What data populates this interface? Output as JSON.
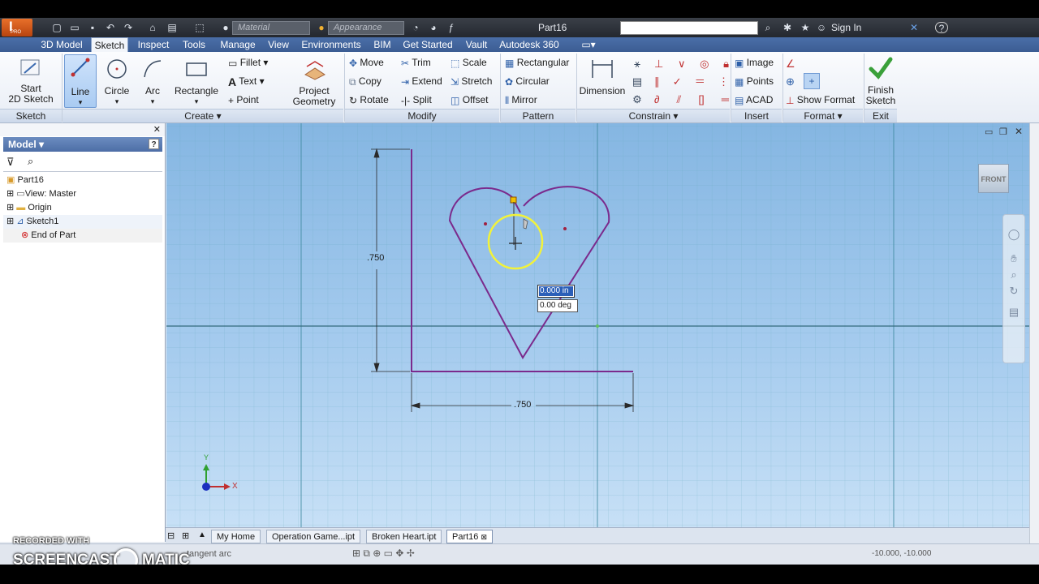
{
  "title_bar": {
    "material_placeholder": "Material",
    "appearance_placeholder": "Appearance",
    "doc_title": "Part16",
    "sign_in": "Sign In",
    "help": "?"
  },
  "tabs": [
    "3D Model",
    "Sketch",
    "Inspect",
    "Tools",
    "Manage",
    "View",
    "Environments",
    "BIM",
    "Get Started",
    "Vault",
    "Autodesk 360"
  ],
  "ribbon": {
    "sketch_panel": {
      "start": "Start",
      "start2": "2D Sketch",
      "label": "Sketch"
    },
    "create": {
      "line": "Line",
      "circle": "Circle",
      "arc": "Arc",
      "rectangle": "Rectangle",
      "fillet": "Fillet",
      "text": "Text",
      "point": "Point",
      "project": "Project",
      "geometry": "Geometry",
      "label": "Create"
    },
    "modify": {
      "move": "Move",
      "copy": "Copy",
      "rotate": "Rotate",
      "trim": "Trim",
      "extend": "Extend",
      "split": "Split",
      "scale": "Scale",
      "stretch": "Stretch",
      "offset": "Offset",
      "label": "Modify"
    },
    "pattern": {
      "rectangular": "Rectangular",
      "circular": "Circular",
      "mirror": "Mirror",
      "label": "Pattern"
    },
    "constrain": {
      "dimension": "Dimension",
      "label": "Constrain"
    },
    "insert": {
      "image": "Image",
      "points": "Points",
      "acad": "ACAD",
      "label": "Insert"
    },
    "format": {
      "show_format": "Show Format",
      "label": "Format"
    },
    "exit": {
      "finish": "Finish",
      "finish2": "Sketch",
      "label": "Exit"
    }
  },
  "browser": {
    "header": "Model",
    "items": [
      "Part16",
      "View: Master",
      "Origin",
      "Sketch1",
      "End of Part"
    ]
  },
  "canvas": {
    "viewcube": "FRONT",
    "dim_vertical": ".750",
    "dim_horizontal": ".750",
    "input_length": "0.000 in",
    "input_angle": "0.00 deg",
    "axis_x": "X",
    "axis_y": "Y"
  },
  "doc_tabs": [
    "My Home",
    "Operation Game...ipt",
    "Broken Heart.ipt",
    "Part16"
  ],
  "status": {
    "watermark_top": "RECORDED WITH",
    "watermark_brand": "SCREENCAST",
    "watermark_brand2": "MATIC",
    "hint": "tangent arc",
    "coords": "-10.000, -10.000"
  },
  "colors": {
    "sketch_line": "#7b2a8c",
    "canvas_top": "#85b6e2",
    "canvas_bottom": "#c7e0f6",
    "ribbon_tab": "#3c5d93"
  }
}
